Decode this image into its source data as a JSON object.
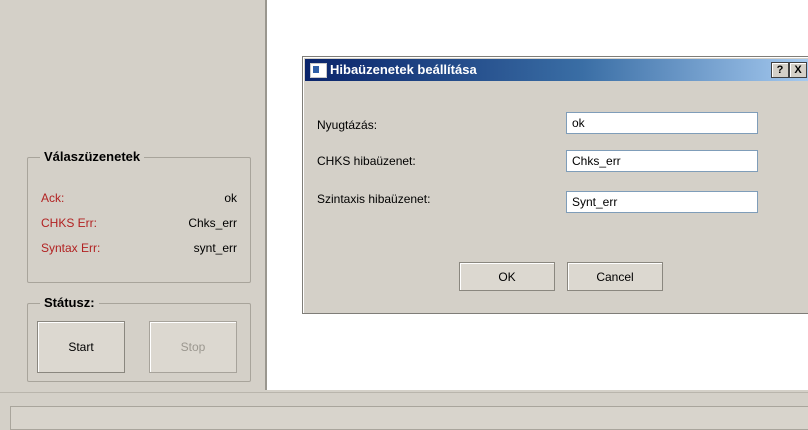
{
  "responses_group": {
    "title": "Válaszüzenetek",
    "rows": [
      {
        "label": "Ack:",
        "value": "ok"
      },
      {
        "label": "CHKS Err:",
        "value": "Chks_err"
      },
      {
        "label": "Syntax Err:",
        "value": "synt_err"
      }
    ]
  },
  "status_group": {
    "title": "Státusz:",
    "start_label": "Start",
    "stop_label": "Stop"
  },
  "dialog": {
    "title": "Hibaüzenetek beállítása",
    "help_label": "?",
    "close_label": "X",
    "fields": [
      {
        "label": "Nyugtázás:",
        "value": "ok"
      },
      {
        "label": "CHKS hibaüzenet:",
        "value": "Chks_err"
      },
      {
        "label": "Szintaxis hibaüzenet:",
        "value": "Synt_err"
      }
    ],
    "ok_label": "OK",
    "cancel_label": "Cancel"
  }
}
